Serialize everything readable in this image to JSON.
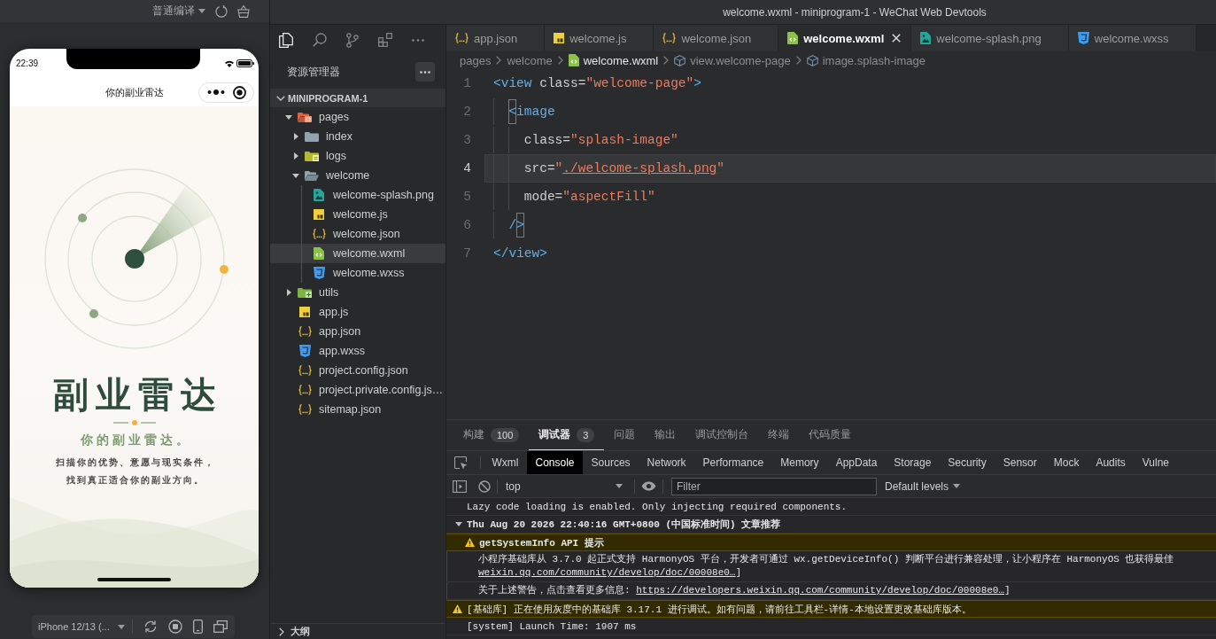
{
  "window": {
    "title": "welcome.wxml - miniprogram-1 - WeChat Web Devtools"
  },
  "simulator": {
    "compile_mode": "普通编译",
    "phone": {
      "time": "22:39",
      "nav_title": "你的副业雷达",
      "app_title": "副业雷达",
      "tagline": "你的副业雷达。",
      "description": [
        "扫描你的优势、意愿与现实条件，",
        "找到真正适合你的副业方向。"
      ]
    },
    "device": "iPhone 12/13 (..."
  },
  "explorer": {
    "title": "资源管理器",
    "project": {
      "label": "MINIPROGRAM-1",
      "expanded": true
    },
    "tree": [
      {
        "label": "pages",
        "kind": "pagefolder",
        "expanded": true,
        "selected": false,
        "children": [
          {
            "label": "index",
            "kind": "folder",
            "expanded": false,
            "selected": false
          },
          {
            "label": "logs",
            "kind": "notefolder",
            "expanded": false,
            "selected": false
          },
          {
            "label": "welcome",
            "kind": "folder",
            "expanded": true,
            "selected": false,
            "children": [
              {
                "label": "welcome-splash.png",
                "kind": "image",
                "selected": false
              },
              {
                "label": "welcome.js",
                "kind": "js",
                "selected": false
              },
              {
                "label": "welcome.json",
                "kind": "json",
                "selected": false
              },
              {
                "label": "welcome.wxml",
                "kind": "wxml",
                "selected": true
              },
              {
                "label": "welcome.wxss",
                "kind": "wxss",
                "selected": false
              }
            ]
          }
        ]
      },
      {
        "label": "utils",
        "kind": "addfolder",
        "expanded": false,
        "selected": false
      },
      {
        "label": "app.js",
        "kind": "js",
        "selected": false
      },
      {
        "label": "app.json",
        "kind": "json",
        "selected": false
      },
      {
        "label": "app.wxss",
        "kind": "wxss",
        "selected": false
      },
      {
        "label": "project.config.json",
        "kind": "json",
        "selected": false
      },
      {
        "label": "project.private.config.js…",
        "kind": "json",
        "selected": false
      },
      {
        "label": "sitemap.json",
        "kind": "json",
        "selected": false
      }
    ],
    "outline": {
      "label": "大纲",
      "expanded": false
    }
  },
  "editor": {
    "tabs": [
      {
        "label": "app.json",
        "kind": "json",
        "selected": false
      },
      {
        "label": "welcome.js",
        "kind": "js",
        "selected": false
      },
      {
        "label": "welcome.json",
        "kind": "json",
        "selected": false
      },
      {
        "label": "welcome.wxml",
        "kind": "wxml",
        "selected": true
      },
      {
        "label": "welcome-splash.png",
        "kind": "image",
        "selected": false
      },
      {
        "label": "welcome.wxss",
        "kind": "wxss",
        "selected": false
      }
    ],
    "breadcrumb": [
      {
        "label": "pages",
        "kind": "folder"
      },
      {
        "label": "welcome",
        "kind": "folder"
      },
      {
        "label": "welcome.wxml",
        "kind": "wxml"
      },
      {
        "label": "view.welcome-page",
        "kind": "element"
      },
      {
        "label": "image.splash-image",
        "kind": "element"
      }
    ],
    "lines": [
      {
        "n": "1",
        "current": false,
        "tokens": [
          {
            "kind": "tag",
            "text": "<view"
          },
          {
            "kind": "attr",
            "text": " class="
          },
          {
            "kind": "value",
            "text": "\"welcome-page\""
          },
          {
            "kind": "tag",
            "text": ">"
          }
        ],
        "children": [
          {
            "n": "2",
            "current": false,
            "tokens": [
              {
                "kind": "match",
                "text": "<"
              },
              {
                "kind": "tag",
                "text": "image"
              }
            ],
            "children": [
              {
                "n": "3",
                "current": false,
                "tokens": [
                  {
                    "kind": "attr",
                    "text": "class="
                  },
                  {
                    "kind": "value",
                    "text": "\"splash-image\""
                  }
                ]
              },
              {
                "n": "4",
                "current": true,
                "tokens": [
                  {
                    "kind": "attr",
                    "text": "src="
                  },
                  {
                    "kind": "value",
                    "text": "\""
                  },
                  {
                    "kind": "link",
                    "text": "./welcome-splash.png"
                  },
                  {
                    "kind": "value",
                    "text": "\""
                  }
                ]
              },
              {
                "n": "5",
                "current": false,
                "tokens": [
                  {
                    "kind": "attr",
                    "text": "mode="
                  },
                  {
                    "kind": "value",
                    "text": "\"aspectFill\""
                  }
                ]
              }
            ]
          },
          {
            "n": "6",
            "current": false,
            "tokens": [
              {
                "kind": "tag",
                "text": "/"
              },
              {
                "kind": "match",
                "text": ">"
              }
            ]
          }
        ]
      },
      {
        "n": "7",
        "current": false,
        "tokens": [
          {
            "kind": "tag",
            "text": "</view>"
          }
        ]
      }
    ]
  },
  "panel": {
    "tabs": [
      {
        "label": "构建",
        "badge": "100",
        "selected": false
      },
      {
        "label": "调试器",
        "badge": "3",
        "selected": true
      },
      {
        "label": "问题",
        "selected": false
      },
      {
        "label": "输出",
        "selected": false
      },
      {
        "label": "调试控制台",
        "selected": false
      },
      {
        "label": "终端",
        "selected": false
      },
      {
        "label": "代码质量",
        "selected": false
      }
    ],
    "devtools_tabs": [
      {
        "label": "Wxml",
        "selected": false
      },
      {
        "label": "Console",
        "selected": true
      },
      {
        "label": "Sources",
        "selected": false
      },
      {
        "label": "Network",
        "selected": false
      },
      {
        "label": "Performance",
        "selected": false
      },
      {
        "label": "Memory",
        "selected": false
      },
      {
        "label": "AppData",
        "selected": false
      },
      {
        "label": "Storage",
        "selected": false
      },
      {
        "label": "Security",
        "selected": false
      },
      {
        "label": "Sensor",
        "selected": false
      },
      {
        "label": "Mock",
        "selected": false
      },
      {
        "label": "Audits",
        "selected": false
      },
      {
        "label": "Vulne",
        "selected": false
      }
    ],
    "context": "top",
    "filter": {
      "placeholder": "Filter"
    },
    "levels": "Default levels",
    "console": [
      {
        "kind": "log",
        "lines": [
          [
            {
              "kind": "text",
              "text": "Lazy code loading is enabled. Only injecting required components."
            }
          ]
        ]
      },
      {
        "kind": "group",
        "expanded": true,
        "lines": [
          [
            {
              "kind": "text",
              "text": "Thu Aug 20 2026 22:40:16 GMT+0800 (中国标准时间) 文章推荐"
            }
          ]
        ]
      },
      {
        "kind": "warning-title",
        "lines": [
          [
            {
              "kind": "text",
              "text": "getSystemInfo API 提示"
            }
          ]
        ]
      },
      {
        "kind": "detail",
        "lines": [
          [
            {
              "kind": "text",
              "text": "小程序基础库从 3.7.0 起正式支持 HarmonyOS 平台，开发者可通过 wx.getDeviceInfo() 判断平台进行兼容处理，让小程序在 HarmonyOS 也获得最佳"
            }
          ],
          [
            {
              "kind": "link",
              "text": "weixin.qq.com/community/develop/doc/00008e0…"
            },
            {
              "kind": "text",
              "text": "]"
            }
          ]
        ]
      },
      {
        "kind": "detail",
        "lines": [
          [
            {
              "kind": "text",
              "text": "关于上述警告，点击查看更多信息: "
            },
            {
              "kind": "link",
              "text": "https://developers.weixin.qq.com/community/develop/doc/00008e0…"
            },
            {
              "kind": "text",
              "text": "]"
            }
          ]
        ]
      },
      {
        "kind": "warning",
        "lines": [
          [
            {
              "kind": "text",
              "text": "[基础库] 正在使用灰度中的基础库 3.17.1 进行调试。如有问题，请前往工具栏-详情-本地设置更改基础库版本。"
            }
          ]
        ]
      },
      {
        "kind": "log",
        "lines": [
          [
            {
              "kind": "text",
              "text": "[system] Launch Time: 1907 ms"
            }
          ]
        ]
      }
    ]
  }
}
